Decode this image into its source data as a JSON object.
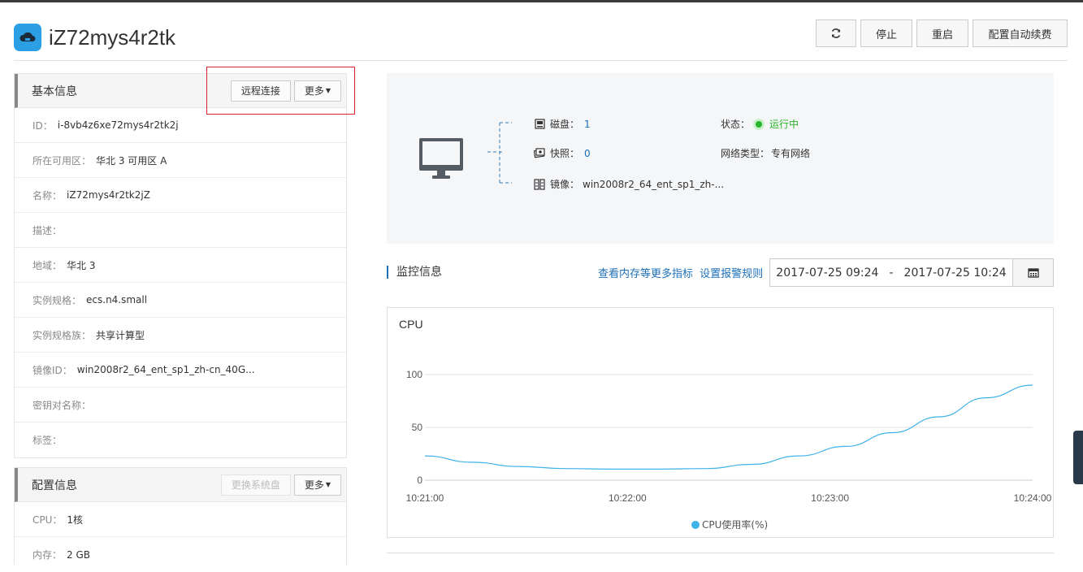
{
  "header": {
    "title": "iZ72mys4r2tk",
    "icon": "cloud-server-icon",
    "actions": {
      "refresh_icon": "refresh-icon",
      "stop": "停止",
      "restart": "重启",
      "auto_renew": "配置自动续费"
    }
  },
  "basic_info": {
    "title": "基本信息",
    "remote_connect": "远程连接",
    "more": "更多",
    "rows": [
      {
        "label": "ID：",
        "value": "i-8vb4z6xe72mys4r2tk2j"
      },
      {
        "label": "所在可用区：",
        "value": "华北 3 可用区 A"
      },
      {
        "label": "名称：",
        "value": "iZ72mys4r2tk2jZ"
      },
      {
        "label": "描述：",
        "value": ""
      },
      {
        "label": "地域：",
        "value": "华北 3"
      },
      {
        "label": "实例规格：",
        "value": "ecs.n4.small"
      },
      {
        "label": "实例规格族：",
        "value": "共享计算型"
      },
      {
        "label": "镜像ID：",
        "value": "win2008r2_64_ent_sp1_zh-cn_40G..."
      },
      {
        "label": "密钥对名称：",
        "value": ""
      },
      {
        "label": "标签：",
        "value": ""
      }
    ]
  },
  "config_info": {
    "title": "配置信息",
    "replace_disk": "更换系统盘",
    "more": "更多",
    "rows": [
      {
        "label": "CPU：",
        "value": "1核"
      },
      {
        "label": "内存：",
        "value": "2 GB"
      }
    ]
  },
  "overview": {
    "disk_label": "磁盘：",
    "disk_value": "1",
    "snapshot_label": "快照：",
    "snapshot_value": "0",
    "image_label": "镜像：",
    "image_value": "win2008r2_64_ent_sp1_zh-...",
    "status_label": "状态：",
    "status_value": "运行中",
    "network_label": "网络类型：",
    "network_value": "专有网络"
  },
  "monitor": {
    "title": "监控信息",
    "link_more_metrics": "查看内存等更多指标",
    "link_alarm": "设置报警规则",
    "date_from": "2017-07-25 09:24",
    "date_sep": "-",
    "date_to": "2017-07-25 10:24"
  },
  "chart_data": {
    "type": "line",
    "title": "CPU",
    "x": [
      "10:21:00",
      "10:22:00",
      "10:23:00",
      "10:24:00"
    ],
    "x_minutes": [
      0,
      0.25,
      0.5,
      0.75,
      1,
      1.25,
      1.5,
      1.75,
      2,
      2.25,
      2.5,
      2.75,
      3
    ],
    "series": [
      {
        "name": "CPU使用率(%)",
        "values": [
          23,
          17,
          13,
          11,
          10.5,
          10.5,
          11,
          15,
          23,
          32,
          45,
          60,
          78,
          90
        ]
      }
    ],
    "yticks": [
      0,
      50,
      100
    ],
    "ylim": [
      0,
      100
    ],
    "grid": true,
    "legend": "bottom",
    "color": "#3fb2e8"
  }
}
